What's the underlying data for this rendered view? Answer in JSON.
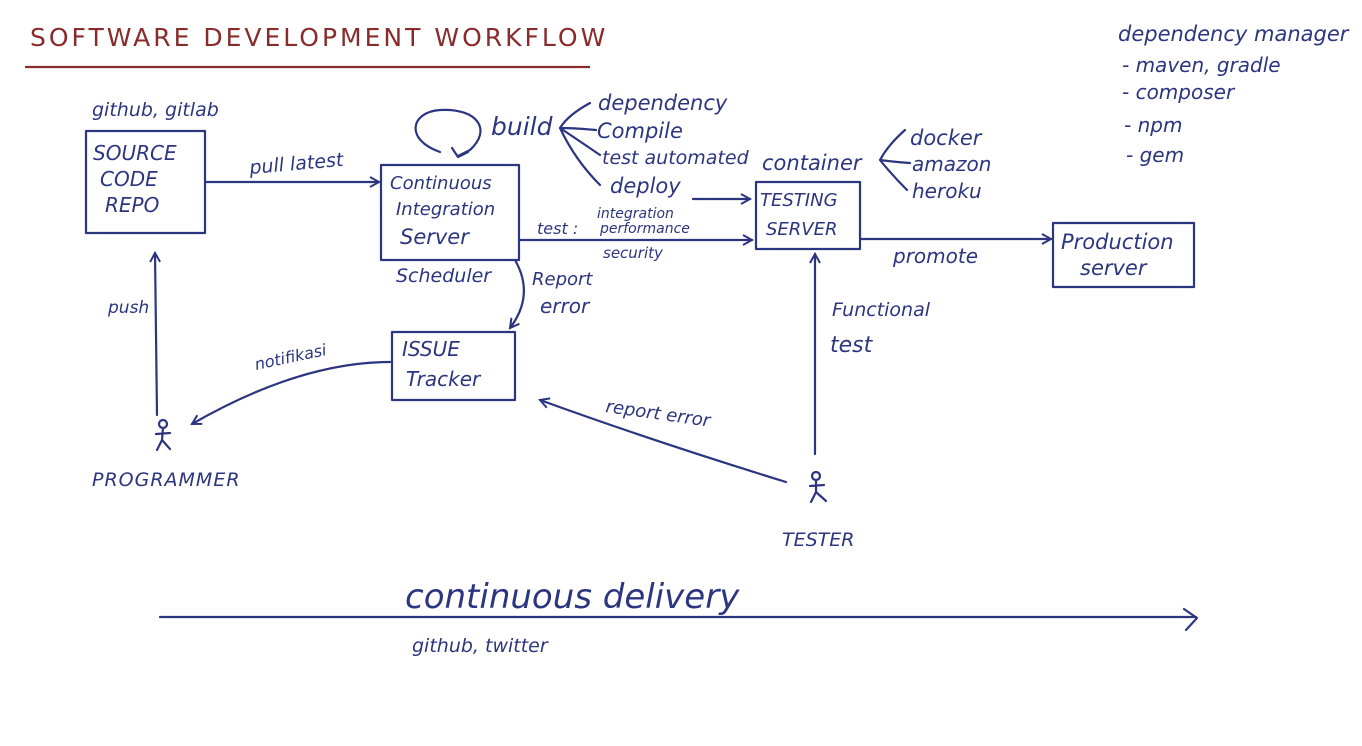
{
  "title": "SOFTWARE DEVELOPMENT WORKFLOW",
  "colors": {
    "ink": "#2c3580",
    "title": "#8a2b2b",
    "background": "#ffffff"
  },
  "nodes": {
    "source_repo": {
      "lines": [
        "SOURCE",
        "CODE",
        "REPO"
      ],
      "note": "github, gitlab"
    },
    "ci_server": {
      "lines": [
        "Continuous",
        "Integration",
        "Server"
      ],
      "sublabel": "Scheduler"
    },
    "issue_tracker": {
      "lines": [
        "ISSUE",
        "Tracker"
      ]
    },
    "testing_server": {
      "lines": [
        "TESTING",
        "SERVER"
      ],
      "container_label": "container"
    },
    "production_server": {
      "lines": [
        "Production",
        "server"
      ]
    },
    "programmer": {
      "label": "PROGRAMMER"
    },
    "tester": {
      "label": "TESTER"
    }
  },
  "build": {
    "label": "build",
    "steps": [
      "dependency",
      "Compile",
      "test automated",
      "deploy"
    ]
  },
  "container_providers": [
    "docker",
    "amazon",
    "heroku"
  ],
  "edges": {
    "pull_latest": "pull latest",
    "test_prefix": "test :",
    "test_types": [
      "integration",
      "performance",
      "security"
    ],
    "report_error_ci": [
      "Report",
      "error"
    ],
    "notifikasi": "notifikasi",
    "push": "push",
    "promote": "promote",
    "functional_test": [
      "Functional",
      "test"
    ],
    "report_error_tester": "report error"
  },
  "dependency_managers": {
    "heading": "dependency manager",
    "items": [
      "- maven, gradle",
      "- composer",
      "- npm",
      "- gem"
    ]
  },
  "delivery": {
    "label": "continuous delivery",
    "note": "github, twitter"
  }
}
